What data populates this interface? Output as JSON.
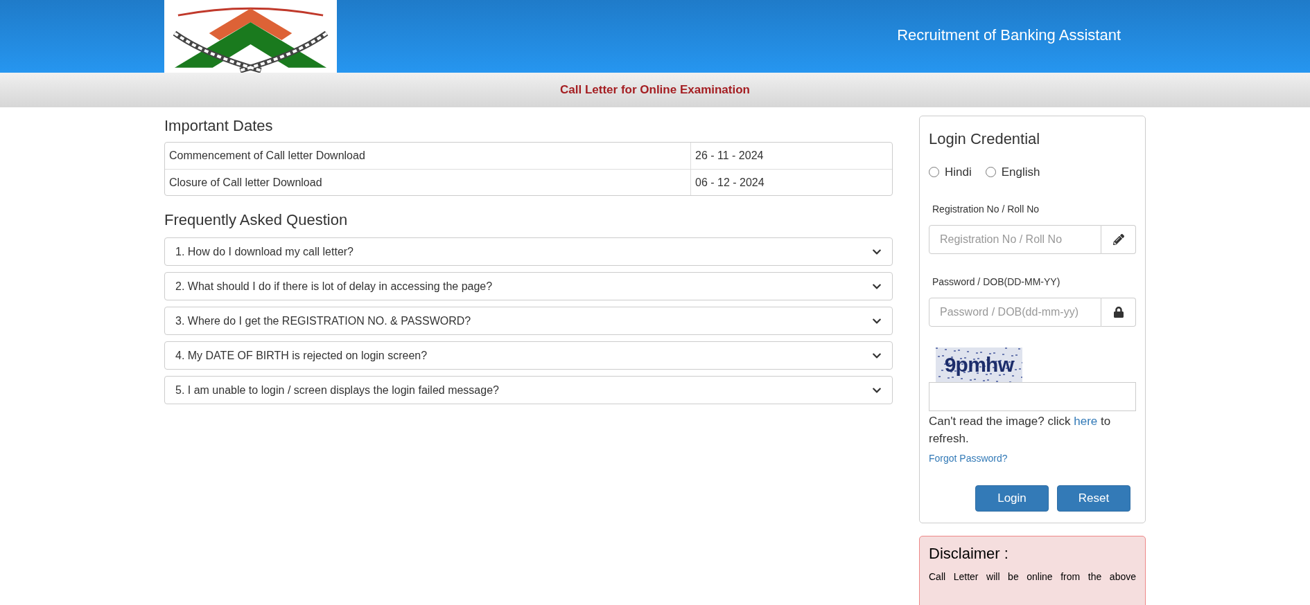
{
  "header": {
    "title": "Recruitment of Banking Assistant"
  },
  "subheader": {
    "title": "Call Letter for Online Examination"
  },
  "important_dates": {
    "heading": "Important Dates",
    "rows": [
      {
        "event": "Commencement of Call letter Download",
        "date": "26 - 11 - 2024"
      },
      {
        "event": "Closure of Call letter Download",
        "date": "06 - 12 - 2024"
      }
    ]
  },
  "faq": {
    "heading": "Frequently Asked Question",
    "items": [
      {
        "question": "1. How do I download my call letter?",
        "expanded": false
      },
      {
        "question": "2. What should I do if there is lot of delay in accessing the page?",
        "expanded": false
      },
      {
        "question": "3. Where do I get the REGISTRATION NO. & PASSWORD?",
        "expanded": false
      },
      {
        "question": "4. My DATE OF BIRTH is rejected on login screen?",
        "expanded": false
      },
      {
        "question": "5. I am unable to login / screen displays the login failed message?",
        "expanded": false
      }
    ]
  },
  "login": {
    "heading": "Login Credential",
    "languages": [
      {
        "label": "Hindi",
        "selected": false
      },
      {
        "label": "English",
        "selected": false
      }
    ],
    "fields": [
      {
        "label": "Registration No / Roll No",
        "placeholder": "Registration No / Roll No",
        "kind": "text"
      },
      {
        "label": "Password / DOB(DD-MM-YY)",
        "placeholder": "Password / DOB(dd-mm-yy)",
        "kind": "password"
      }
    ],
    "captcha": "9pmhw",
    "refresh_text_before": "Can't read the image? click",
    "refresh_link": "here",
    "refresh_text_after": "to refresh.",
    "forgot_password": "Forgot Password?",
    "buttons": [
      "Login",
      "Reset"
    ]
  },
  "disclaimer": {
    "heading": "Disclaimer :",
    "text": "Call Letter will be online from the above"
  }
}
